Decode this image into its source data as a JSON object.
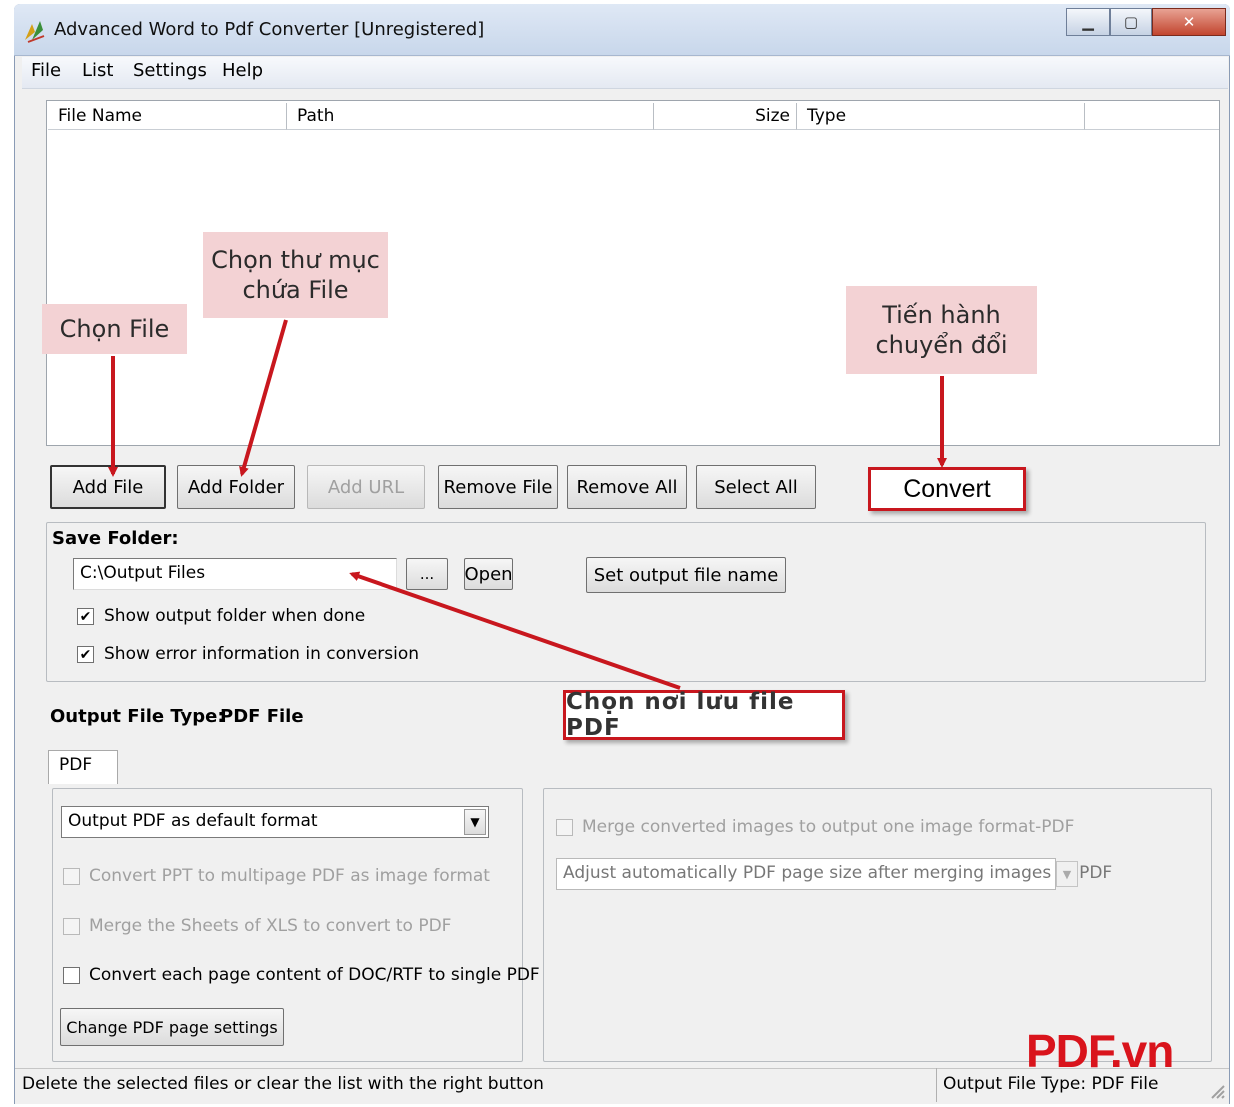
{
  "window": {
    "title": "Advanced Word to Pdf Converter [Unregistered]"
  },
  "menu": [
    "File",
    "List",
    "Settings",
    "Help"
  ],
  "file_list": {
    "columns": [
      "File Name",
      "Path",
      "Size",
      "Type"
    ]
  },
  "toolbar": {
    "add_file": "Add File",
    "add_folder": "Add Folder",
    "add_url": "Add URL",
    "remove_file": "Remove File",
    "remove_all": "Remove All",
    "select_all": "Select All",
    "convert": "Convert"
  },
  "save_folder": {
    "label": "Save Folder:",
    "path": "C:\\Output Files",
    "browse": "...",
    "open": "Open",
    "set_output_name": "Set output file name",
    "show_output_folder": "Show output folder when done",
    "show_errors": "Show error information in conversion"
  },
  "output_type": {
    "label": "Output File Type:",
    "value": "PDF File"
  },
  "tabs": [
    "PDF"
  ],
  "pdf_options": {
    "format_select": "Output PDF as default format",
    "convert_ppt": "Convert PPT to multipage PDF as image format",
    "merge_xls": "Merge the Sheets of XLS to convert to PDF",
    "each_page": "Convert each page content of DOC/RTF to single PDF",
    "page_settings": "Change PDF page settings"
  },
  "image_options": {
    "merge_images": "Merge converted images to output one image format-PDF",
    "adjust_select": "Adjust automatically PDF page size after merging images to PDF"
  },
  "callouts": {
    "choose_file": "Chọn File",
    "choose_folder_l1": "Chọn thư mục",
    "choose_folder_l2": "chứa File",
    "convert_l1": "Tiến hành",
    "convert_l2": "chuyển đổi",
    "save_location": "Chọn nơi lưu file PDF"
  },
  "status": {
    "hint": "Delete the selected files or clear the list with the right button",
    "output_type": "Output File Type:  PDF File"
  },
  "watermark": "PDF.vn",
  "colors": {
    "callout_bg": "#f3d2d4",
    "arrow_red": "#c8171e",
    "watermark_red": "#d9141c"
  }
}
